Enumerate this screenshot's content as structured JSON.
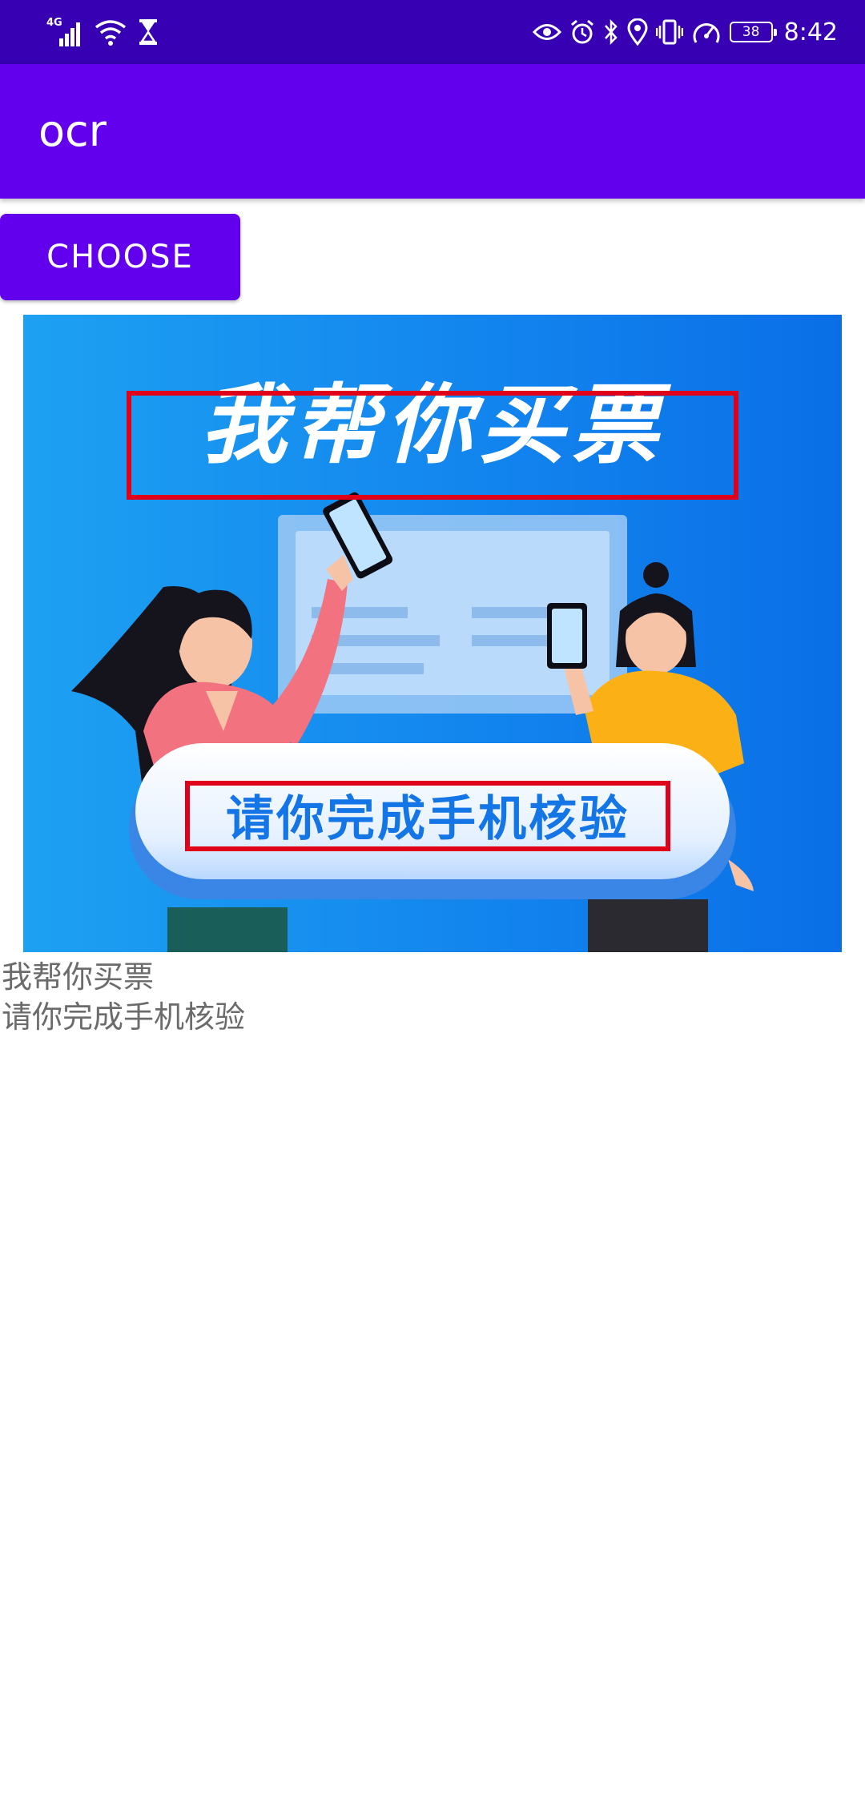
{
  "status_bar": {
    "network": "4G",
    "battery": "38",
    "time": "8:42"
  },
  "app_bar": {
    "title": "ocr"
  },
  "choose_button": {
    "label": "CHOOSE"
  },
  "image": {
    "headline": "我帮你买票",
    "pill_text": "请你完成手机核验"
  },
  "ocr_results": [
    "我帮你买票",
    "请你完成手机核验"
  ],
  "colors": {
    "status_bar": "#3700b3",
    "app_bar": "#6200ee",
    "button": "#6200ee",
    "image_blue": "#1283ee",
    "highlight_box": "#e0001a",
    "result_text": "#6b6b6b"
  }
}
